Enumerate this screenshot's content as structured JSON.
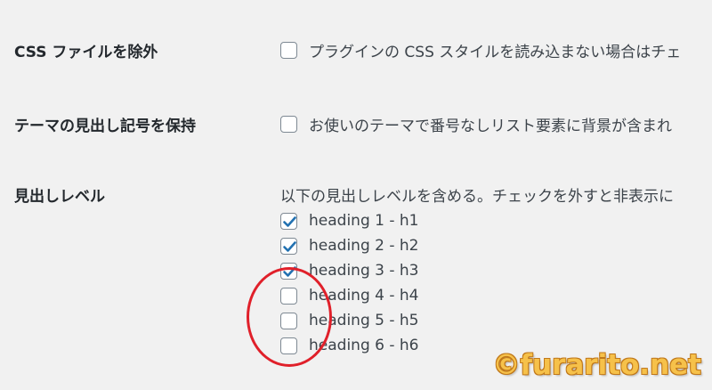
{
  "settings": {
    "exclude_css": {
      "label": "CSS ファイルを除外",
      "checkbox_text": "プラグインの CSS スタイルを読み込まない場合はチェ",
      "checked": false
    },
    "preserve_theme_bullets": {
      "label": "テーマの見出し記号を保持",
      "checkbox_text": "お使いのテーマで番号なしリスト要素に背景が含まれ",
      "checked": false
    },
    "heading_levels": {
      "label": "見出しレベル",
      "description": "以下の見出しレベルを含める。チェックを外すと非表示に",
      "options": [
        {
          "label": "heading 1 - h1",
          "checked": true
        },
        {
          "label": "heading 2 - h2",
          "checked": true
        },
        {
          "label": "heading 3 - h3",
          "checked": true
        },
        {
          "label": "heading 4 - h4",
          "checked": false
        },
        {
          "label": "heading 5 - h5",
          "checked": false
        },
        {
          "label": "heading 6 - h6",
          "checked": false
        }
      ]
    }
  },
  "watermark": "©furarito.net",
  "colors": {
    "checkmark": "#2271b1",
    "annotation_circle": "#e0202a",
    "watermark": "#f6c14a"
  }
}
